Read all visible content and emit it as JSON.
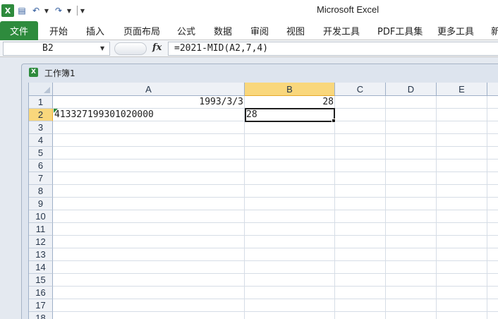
{
  "app": {
    "title": "Microsoft Excel"
  },
  "ribbon": {
    "file_tab": "文件",
    "tabs": [
      "开始",
      "插入",
      "页面布局",
      "公式",
      "数据",
      "审阅",
      "视图",
      "开发工具",
      "PDF工具集",
      "更多工具",
      "新"
    ]
  },
  "formula_bar": {
    "name_box": "B2",
    "fx_label": "fx",
    "formula": "=2021-MID(A2,7,4)"
  },
  "workbook": {
    "title": "工作簿1"
  },
  "grid": {
    "columns": [
      "A",
      "B",
      "C",
      "D",
      "E"
    ],
    "selected_column": "B",
    "rows": [
      "1",
      "2",
      "3",
      "4",
      "5",
      "6",
      "7",
      "8",
      "9",
      "10",
      "11",
      "12",
      "13",
      "14",
      "15",
      "16",
      "17",
      "18"
    ],
    "selected_row": "2",
    "cells": {
      "A1": "1993/3/3",
      "B1": "28",
      "A2": "413327199301020000",
      "B2": "28"
    }
  },
  "colors": {
    "file_tab": "#2e8b3d",
    "selected_header": "#f9d77c"
  }
}
